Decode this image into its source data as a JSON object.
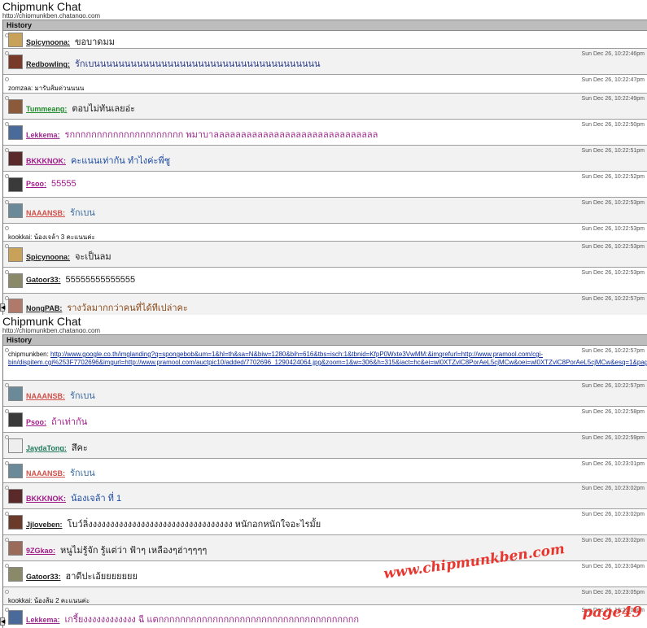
{
  "colors": {
    "history_bar": "#bdbdbd",
    "row_alt": "#f2f2f2",
    "watermark": "#e8352d"
  },
  "panels": [
    {
      "title": "Chipmunk Chat",
      "url": "http://chipmunkben.chatango.com",
      "history_label": "History",
      "messages": [
        {
          "user": "Spicynoona:",
          "text": "ขอบาดมม",
          "ts": "",
          "user_color": "#1b1b1b",
          "text_color": "#1b1b1b",
          "avatar": "#c9a25a",
          "h": 22
        },
        {
          "user": "Redbowling:",
          "text": "รักเบนนนนนนนนนนนนนนนนนนนนนนนนนนนนนนนนนนนนน",
          "ts": "Sun Dec 26, 10:22:46pm",
          "user_color": "#1b1b1b",
          "text_color": "#2a3a8a",
          "avatar": "#7a3a2a",
          "h": 32
        },
        {
          "user": "",
          "text": "zomzaa: มารับส้มด่วนนนน",
          "ts": "Sun Dec 26, 10:22:47pm",
          "plain": true,
          "h": 23
        },
        {
          "user": "Tummeang:",
          "text": "ตอบไม่ทันเลยอ่ะ",
          "ts": "Sun Dec 26, 10:22:49pm",
          "user_color": "#1e8a2a",
          "text_color": "#1b1b1b",
          "avatar": "#8a5a3a",
          "h": 32
        },
        {
          "user": "Lekkema:",
          "text": "รกกกกกกกกกกกกกกกกกกกกก พมาบาลลลลลลลลลลลลลลลลลลลลลลลลลลลลลล",
          "ts": "Sun Dec 26, 10:22:50pm",
          "user_color": "#9a2a8a",
          "text_color": "#9a2a8a",
          "avatar": "#4a6a9a",
          "h": 32
        },
        {
          "user": "BKKKNOK:",
          "text": "คะแนนเท่ากัน ทำไงค่ะพี่ชู",
          "ts": "Sun Dec 26, 10:22:51pm",
          "user_color": "#a21b8a",
          "text_color": "#1b4aa0",
          "avatar": "#5a2a2a",
          "h": 32
        },
        {
          "user": "Psoo:",
          "text": "55555",
          "ts": "Sun Dec 26, 10:22:52pm",
          "user_color": "#a21b8a",
          "text_color": "#a21b8a",
          "avatar": "#3a3a3a",
          "h": 32
        },
        {
          "user": "NAAANSB:",
          "text": "รักเบน",
          "ts": "Sun Dec 26, 10:22:53pm",
          "user_color": "#d0504a",
          "text_color": "#3a6aa0",
          "avatar": "#6a8a9a",
          "h": 32
        },
        {
          "user": "",
          "text": "kookkai: น้องเจล้า 3 คะแนนค่ะ",
          "ts": "Sun Dec 26, 10:22:53pm",
          "plain": true,
          "h": 22
        },
        {
          "user": "Spicynoona:",
          "text": "จะเป็นลม",
          "ts": "Sun Dec 26, 10:22:53pm",
          "user_color": "#1b1b1b",
          "text_color": "#1b1b1b",
          "avatar": "#c9a25a",
          "h": 32
        },
        {
          "user": "Gatoor33:",
          "text": "55555555555555",
          "ts": "Sun Dec 26, 10:22:53pm",
          "user_color": "#1b1b1b",
          "text_color": "#1b1b1b",
          "avatar": "#8a8a6a",
          "h": 32
        },
        {
          "user": "NongPAB:",
          "text": "รางวัลมากกว่าคนที่ได้ทีเปล่าคะ",
          "ts": "Sun Dec 26, 10:22:57pm",
          "user_color": "#1b1b1b",
          "text_color": "#8a4a1a",
          "avatar": "#b07a6a",
          "h": 30
        }
      ]
    },
    {
      "title": "Chipmunk Chat",
      "url": "http://chipmunkben.chatango.com",
      "history_label": "History",
      "messages": [
        {
          "user": "",
          "text": "chipmunkben: ",
          "link": "http://www.google.co.th/imglanding?q=spongebob&um=1&hl=th&sa=N&biw=1280&bih=616&tbs=isch:1&tbnid=KfpP0Wxte3VwMM:&imgrefurl=http://www.pramool.com/cgi-bin/dispitem.cgi%253F7702696&imgurl=http://www.pramool.com/auctpic10/added/7702696_1290424064.jpg&zoom=1&w=306&h=315&iact=hc&ei=wl0XTZvlC8PorAeL5cjMCw&oei=wl0XTZvlC8PorAeL5cjMCw&esq=1&page=1&tbnh=152&tbnw=148&start=0&ndsp=18&ved=1t:429,r:0,s:0",
          "ts": "Sun Dec 26, 10:22:57pm",
          "plain": true,
          "multi": true,
          "h": 43
        },
        {
          "user": "NAAANSB:",
          "text": "รักเบน",
          "ts": "Sun Dec 26, 10:22:57pm",
          "user_color": "#d0504a",
          "text_color": "#3a6aa0",
          "avatar": "#6a8a9a",
          "h": 32
        },
        {
          "user": "Psoo:",
          "text": "ถ้าเท่ากัน",
          "ts": "Sun Dec 26, 10:22:58pm",
          "user_color": "#a21b8a",
          "text_color": "#a21b8a",
          "avatar": "#3a3a3a",
          "h": 32
        },
        {
          "user": "JaydaTong:",
          "text": "สึคะ",
          "ts": "Sun Dec 26, 10:22:59pm",
          "user_color": "#1e7a5a",
          "text_color": "#1b1b1b",
          "avatar": "#eeeeee",
          "h": 32
        },
        {
          "user": "NAAANSB:",
          "text": "รักเบน",
          "ts": "Sun Dec 26, 10:23:01pm",
          "user_color": "#d0504a",
          "text_color": "#3a6aa0",
          "avatar": "#6a8a9a",
          "h": 30
        },
        {
          "user": "BKKKNOK:",
          "text": "น้องเจล้า ที่ 1",
          "ts": "Sun Dec 26, 10:23:02pm",
          "user_color": "#a21b8a",
          "text_color": "#1b4aa0",
          "avatar": "#5a2a2a",
          "h": 32
        },
        {
          "user": "Jjloveben:",
          "text": "โบว์ลิ่งงงงงงงงงงงงงงงงงงงงงงงงงงงงงงงงง หนักอกหนักใจอะไรมั้ย",
          "ts": "Sun Dec 26, 10:23:02pm",
          "user_color": "#1b1b1b",
          "text_color": "#1b1b1b",
          "avatar": "#6a3a2a",
          "h": 32
        },
        {
          "user": "9ZGkao:",
          "text": "หนูไม่รู้จัก รู้แต่ว่า ฟ้าๆ เหลืองๆฮ่าๆๆๆๆ",
          "ts": "Sun Dec 26, 10:23:02pm",
          "user_color": "#a21b8a",
          "text_color": "#1b1b1b",
          "avatar": "#9a6a5a",
          "h": 32
        },
        {
          "user": "Gatoor33:",
          "text": "ฮาดีปะเอ้ยยยยยยย",
          "ts": "Sun Dec 26, 10:23:04pm",
          "user_color": "#1b1b1b",
          "text_color": "#1b1b1b",
          "avatar": "#8a8a6a",
          "h": 32
        },
        {
          "user": "",
          "text": "kookkai: น้องส้ม 2 คะแนนค่ะ",
          "ts": "Sun Dec 26, 10:23:05pm",
          "plain": true,
          "h": 22
        },
        {
          "user": "Lekkema:",
          "text": "เกรี้ยงงงงงงงงงงงง ฉี แตกกกกกกกกกกกกกกกกกกกกกกกกกกกกกกกกกกกกก",
          "ts": "Sun Dec 26, 10:23:06pm",
          "user_color": "#9a2a8a",
          "text_color": "#9a2a8a",
          "avatar": "#4a6a9a",
          "h": 30
        }
      ]
    }
  ],
  "watermark": {
    "site": "www.chipmunkben.com",
    "page": "page49"
  }
}
